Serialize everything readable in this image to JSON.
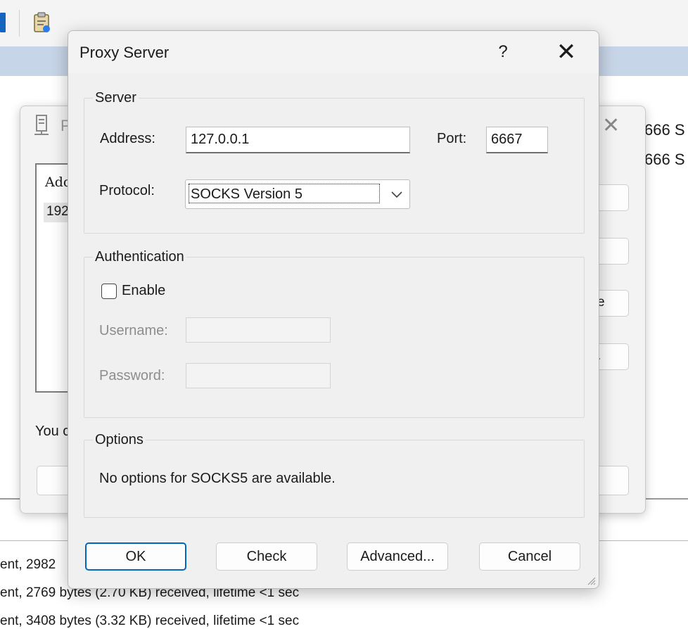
{
  "background": {
    "dialog_title_fragment": "P",
    "list_header_fragment": "Add",
    "list_row_fragment": "192",
    "right_button_fragments": [
      "",
      "",
      "e",
      "."
    ],
    "note_fragment": "You c",
    "right_ports": [
      "666 S",
      "666 S"
    ],
    "log_lines": [
      "ent, 2982",
      "ent, 2769 bytes (2.70 KB) received, lifetime <1 sec",
      "ent, 3408 bytes (3.32 KB) received, lifetime <1 sec"
    ]
  },
  "dialog": {
    "title": "Proxy Server",
    "help_glyph": "?",
    "close_glyph": "✕",
    "server": {
      "legend": "Server",
      "address_label": "Address:",
      "address_value": "127.0.0.1",
      "port_label": "Port:",
      "port_value": "6667",
      "protocol_label": "Protocol:",
      "protocol_value": "SOCKS Version 5"
    },
    "authentication": {
      "legend": "Authentication",
      "enable_label": "Enable",
      "enable_checked": false,
      "username_label": "Username:",
      "username_value": "",
      "password_label": "Password:",
      "password_value": ""
    },
    "options": {
      "legend": "Options",
      "message": "No options for SOCKS5 are available."
    },
    "buttons": {
      "ok": "OK",
      "check": "Check",
      "advanced": "Advanced...",
      "cancel": "Cancel"
    }
  },
  "colors": {
    "accent": "#0067c0",
    "toolbar_strip": "#c7d5e8",
    "dialog_bg": "#f0f0f0"
  }
}
